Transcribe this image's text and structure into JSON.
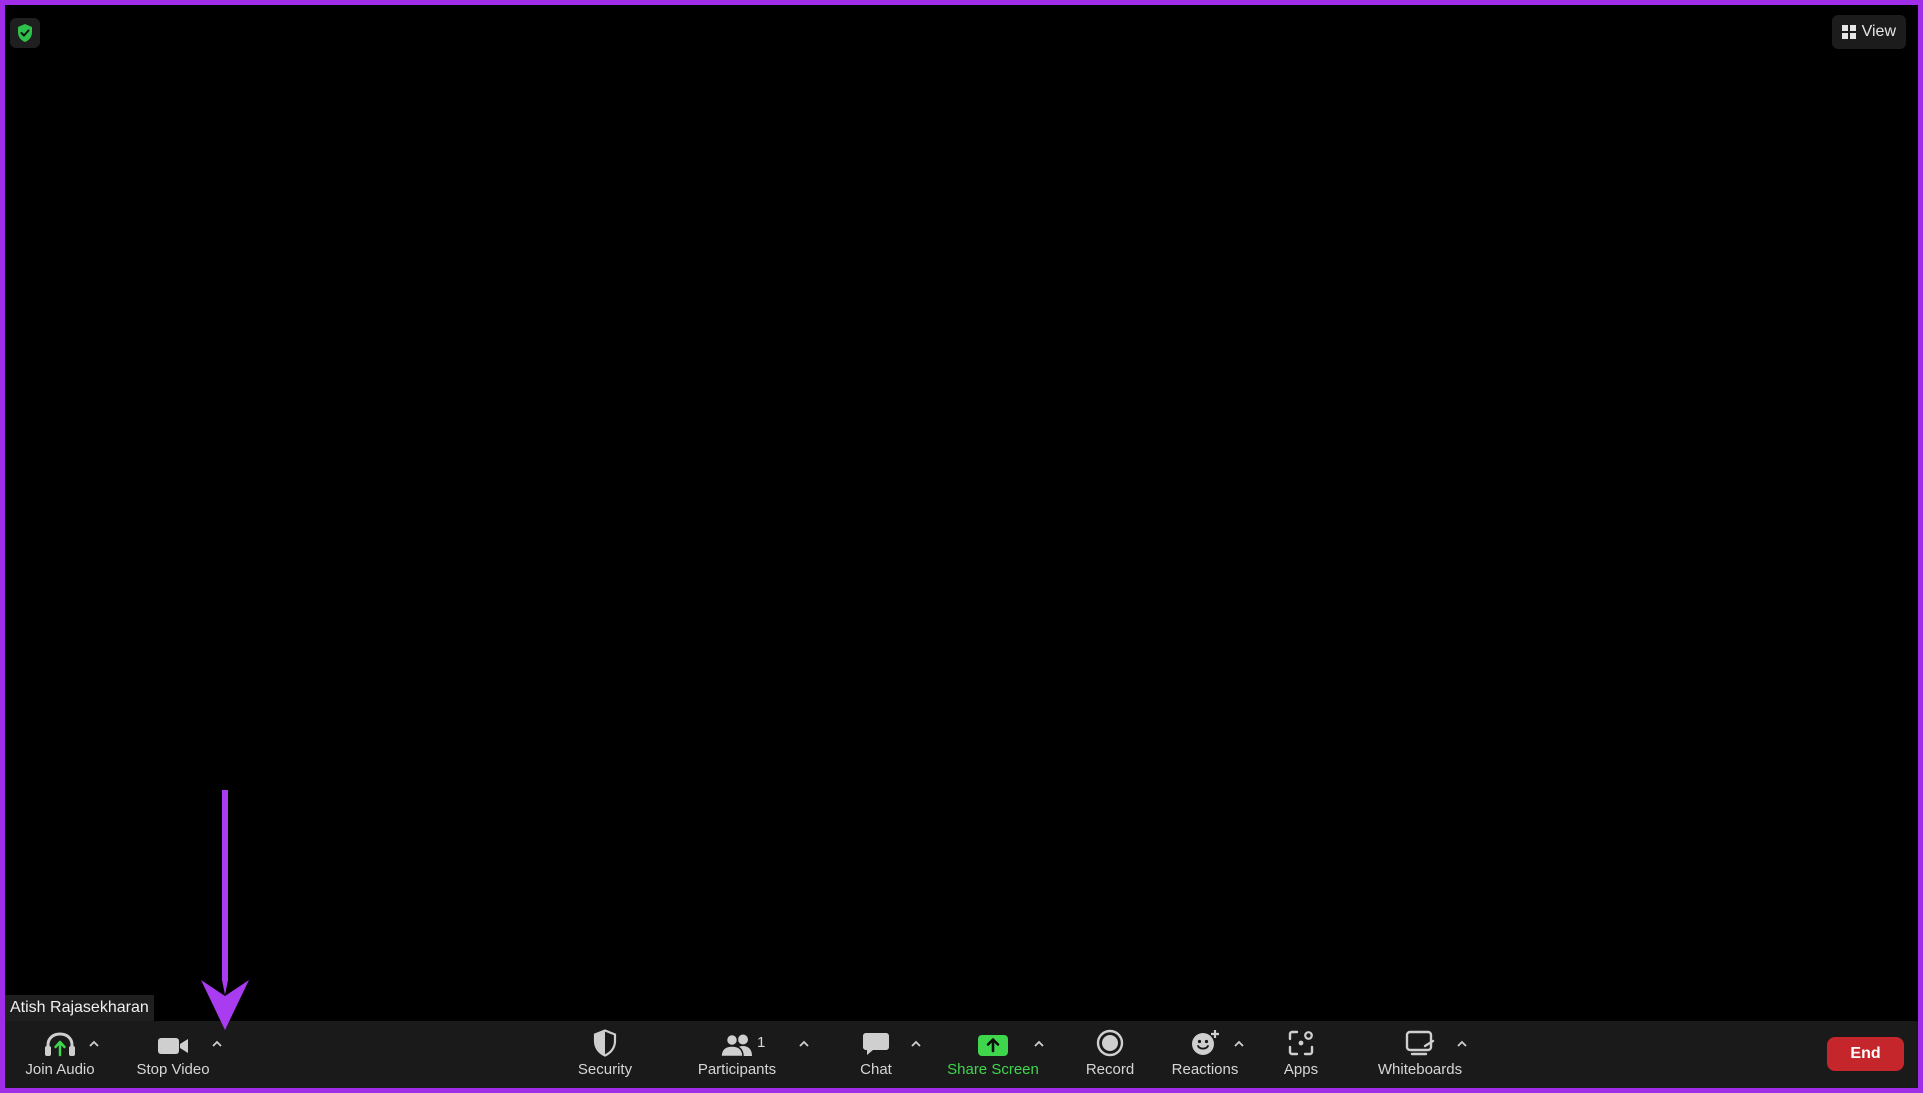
{
  "meeting": {
    "view_label": "View",
    "participant_name": "Atish Rajasekharan",
    "participant_count": "1"
  },
  "toolbar": {
    "join_audio_label": "Join Audio",
    "stop_video_label": "Stop Video",
    "security_label": "Security",
    "participants_label": "Participants",
    "chat_label": "Chat",
    "share_screen_label": "Share Screen",
    "record_label": "Record",
    "reactions_label": "Reactions",
    "apps_label": "Apps",
    "whiteboards_label": "Whiteboards",
    "end_label": "End"
  },
  "icons": {
    "encryption": "shield-check-icon",
    "view": "grid-icon",
    "join_audio": "headphones-icon",
    "stop_video": "video-camera-icon",
    "security": "shield-icon",
    "participants": "people-icon",
    "chat": "chat-bubble-icon",
    "share_screen": "share-arrow-icon",
    "record": "record-icon",
    "reactions": "emoji-icon",
    "apps": "apps-icon",
    "whiteboards": "whiteboard-icon",
    "annotation": "arrow-down-icon"
  },
  "colors": {
    "frame_border": "#a02ee8",
    "share_green": "#3fd64e",
    "end_red": "#c4262b",
    "toolbar_bg": "#1a1a1a",
    "annotation_arrow": "#a93cf0"
  }
}
